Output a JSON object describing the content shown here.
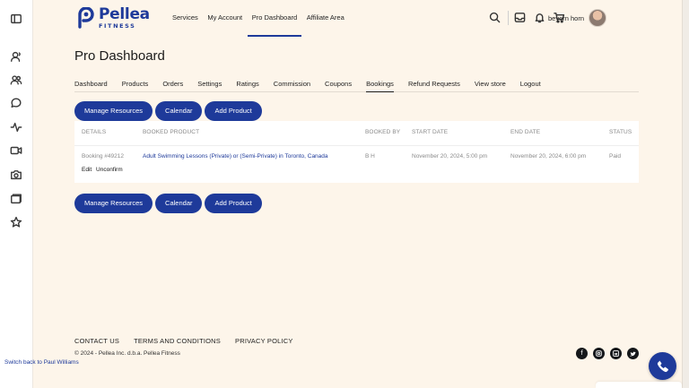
{
  "brand": {
    "name": "Pellea",
    "sub": "FITNESS",
    "color": "#1e3a9a"
  },
  "rail": {
    "icons": [
      "panel-toggle-icon",
      "user-voice-icon",
      "users-icon",
      "chat-bubble-icon",
      "activity-icon",
      "video-icon",
      "camera-icon",
      "folder-icon",
      "star-icon"
    ]
  },
  "nav": {
    "items": [
      {
        "label": "Services"
      },
      {
        "label": "My Account"
      },
      {
        "label": "Pro Dashboard",
        "active": true
      },
      {
        "label": "Affiliate Area"
      }
    ]
  },
  "header": {
    "icons": [
      "search-icon",
      "inbox-icon",
      "bell-icon",
      "cart-icon"
    ],
    "user_name": "beyorn horn"
  },
  "page": {
    "title": "Pro Dashboard"
  },
  "tabs": [
    {
      "label": "Dashboard"
    },
    {
      "label": "Products"
    },
    {
      "label": "Orders"
    },
    {
      "label": "Settings"
    },
    {
      "label": "Ratings"
    },
    {
      "label": "Commission"
    },
    {
      "label": "Coupons"
    },
    {
      "label": "Bookings",
      "active": true
    },
    {
      "label": "Refund Requests"
    },
    {
      "label": "View store"
    },
    {
      "label": "Logout"
    }
  ],
  "actions": {
    "manage_resources": "Manage Resources",
    "calendar": "Calendar",
    "add_product": "Add Product"
  },
  "table": {
    "columns": [
      "DETAILS",
      "BOOKED PRODUCT",
      "BOOKED BY",
      "START DATE",
      "END DATE",
      "STATUS"
    ],
    "rows": [
      {
        "details": "Booking #49212",
        "product": "Adult Swimming Lessons (Private) or (Semi-Private) in Toronto, Canada",
        "booked_by": "B H",
        "start_date": "November 20, 2024, 5:00 pm",
        "end_date": "November 20, 2024, 6:00 pm",
        "status": "Paid",
        "edit_label": "Edit",
        "unconfirm_label": "Unconfirm"
      }
    ]
  },
  "footer": {
    "links": [
      "CONTACT US",
      "TERMS AND CONDITIONS",
      "PRIVACY POLICY"
    ],
    "copyright": "© 2024 - Pellea Inc. d.b.a. Pellea Fitness",
    "switch_back": "Switch back to Paul Williams",
    "socials": [
      "facebook-icon",
      "instagram-icon",
      "linkedin-icon",
      "twitter-icon"
    ]
  }
}
